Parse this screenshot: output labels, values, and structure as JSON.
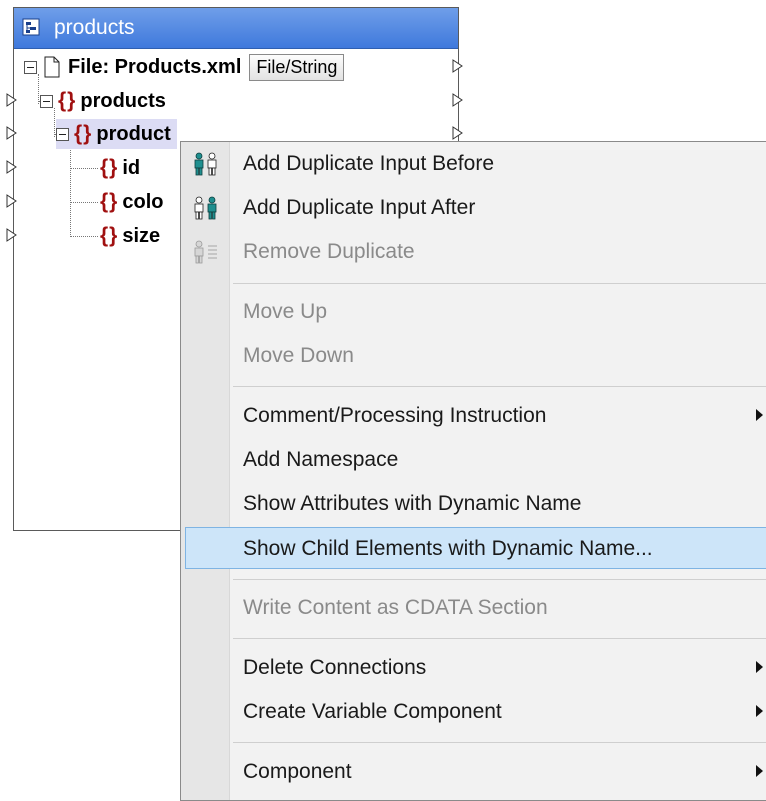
{
  "component": {
    "title": "products",
    "file_label": "File: Products.xml",
    "file_button": "File/String",
    "nodes": [
      "products",
      "product",
      "id",
      "colo",
      "size"
    ]
  },
  "menu": {
    "items": [
      {
        "label": "Add Duplicate Input Before",
        "enabled": true,
        "icon": "duplicate-input-icon"
      },
      {
        "label": "Add Duplicate Input After",
        "enabled": true,
        "icon": "duplicate-input-icon"
      },
      {
        "label": "Remove Duplicate",
        "enabled": false,
        "icon": "remove-duplicate-icon"
      },
      {
        "label": "Move Up",
        "enabled": false
      },
      {
        "label": "Move Down",
        "enabled": false
      },
      {
        "label": "Comment/Processing Instruction",
        "enabled": true,
        "submenu": true
      },
      {
        "label": "Add Namespace",
        "enabled": true
      },
      {
        "label": "Show Attributes with Dynamic Name",
        "enabled": true
      },
      {
        "label": "Show Child Elements with Dynamic Name...",
        "enabled": true,
        "highlighted": true
      },
      {
        "label": "Write Content as CDATA Section",
        "enabled": false
      },
      {
        "label": "Delete Connections",
        "enabled": true,
        "submenu": true
      },
      {
        "label": "Create Variable Component",
        "enabled": true,
        "submenu": true
      },
      {
        "label": "Component",
        "enabled": true,
        "submenu": true
      }
    ]
  },
  "colors": {
    "title_bar": "#4a84e0",
    "element_tag": "#a01010",
    "highlight": "#cde5f9"
  }
}
